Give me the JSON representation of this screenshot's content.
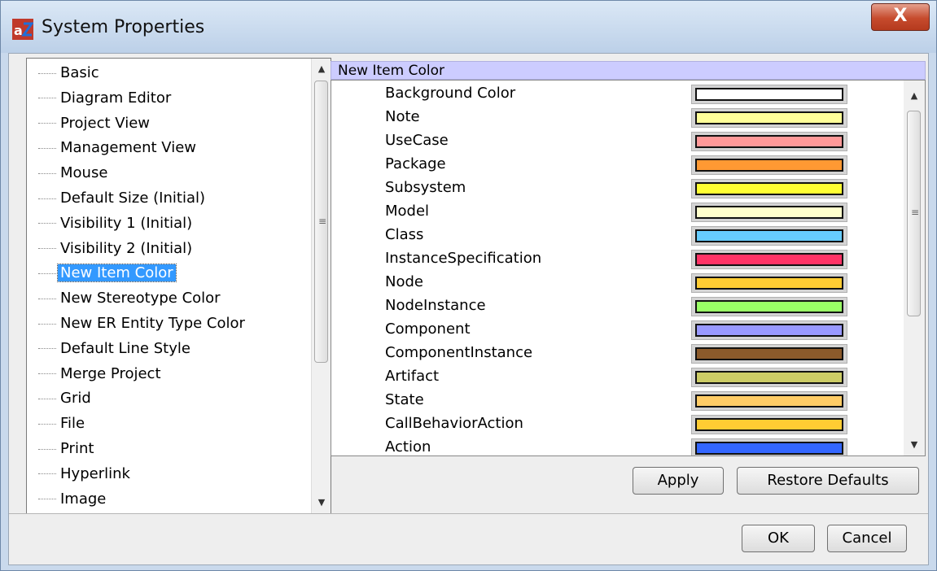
{
  "window": {
    "title": "System Properties",
    "app_icon": "astah-logo",
    "close_label": "X"
  },
  "tree": {
    "items": [
      {
        "label": "Basic"
      },
      {
        "label": "Diagram Editor"
      },
      {
        "label": "Project View"
      },
      {
        "label": "Management View"
      },
      {
        "label": "Mouse"
      },
      {
        "label": "Default Size (Initial)"
      },
      {
        "label": "Visibility 1 (Initial)"
      },
      {
        "label": "Visibility 2 (Initial)"
      },
      {
        "label": "New Item Color",
        "selected": true
      },
      {
        "label": "New Stereotype Color"
      },
      {
        "label": "New ER Entity Type Color"
      },
      {
        "label": "Default Line Style"
      },
      {
        "label": "Merge Project"
      },
      {
        "label": "Grid"
      },
      {
        "label": "File"
      },
      {
        "label": "Print"
      },
      {
        "label": "Hyperlink"
      },
      {
        "label": "Image"
      }
    ]
  },
  "panel": {
    "header": "New Item Color",
    "rows": [
      {
        "name": "Background Color",
        "color": "#ffffff"
      },
      {
        "name": "Note",
        "color": "#ffff99"
      },
      {
        "name": "UseCase",
        "color": "#ff9999"
      },
      {
        "name": "Package",
        "color": "#ff9933"
      },
      {
        "name": "Subsystem",
        "color": "#ffff33"
      },
      {
        "name": "Model",
        "color": "#ffffcc"
      },
      {
        "name": "Class",
        "color": "#66ccff"
      },
      {
        "name": "InstanceSpecification",
        "color": "#ff3366"
      },
      {
        "name": "Node",
        "color": "#ffcc33"
      },
      {
        "name": "NodeInstance",
        "color": "#99ff66"
      },
      {
        "name": "Component",
        "color": "#9999ff"
      },
      {
        "name": "ComponentInstance",
        "color": "#8b5a2b"
      },
      {
        "name": "Artifact",
        "color": "#cccc66"
      },
      {
        "name": "State",
        "color": "#ffcc66"
      },
      {
        "name": "CallBehaviorAction",
        "color": "#ffcc33"
      },
      {
        "name": "Action",
        "color": "#3366ff"
      }
    ],
    "apply_label": "Apply",
    "restore_label": "Restore Defaults"
  },
  "footer": {
    "ok_label": "OK",
    "cancel_label": "Cancel"
  }
}
